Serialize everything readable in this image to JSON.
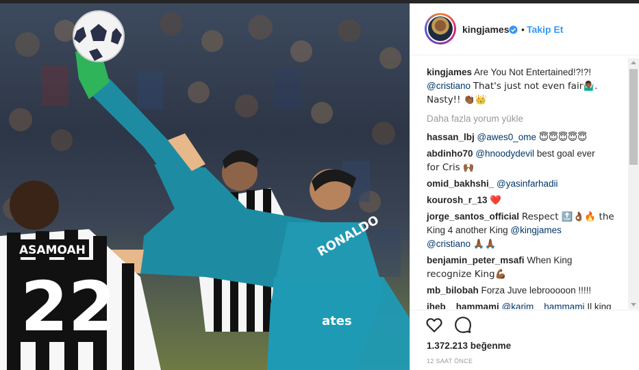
{
  "post": {
    "jersey_name": "ASAMOAH",
    "jersey_number": "22",
    "ball_icon": "football-icon"
  },
  "header": {
    "username": "kingjames",
    "verified_icon": "verified-badge-icon",
    "separator": "•",
    "follow_label": "Takip Et"
  },
  "caption": {
    "username": "kingjames",
    "line1": "Are You Not Entertained!?!?!",
    "line2_mention": "@cristiano",
    "line2_text": "That's just not even fair🤷🏾‍♂️.",
    "line3_text": "Nasty!! 👏🏾👑"
  },
  "load_more": "Daha fazla yorum yükle",
  "comments": [
    {
      "user": "hassan_lbj",
      "mention": "@awes0_ome",
      "text": "😇😇😇😇😇"
    },
    {
      "user": "abdinho70",
      "mention": "@hnoodydevil",
      "text": "best goal ever",
      "text2": "for Cris 🙌🏾"
    },
    {
      "user": "omid_bakhshi_",
      "mention": "@yasinfarhadii",
      "text": ""
    },
    {
      "user": "kourosh_r_13",
      "mention": "",
      "text": "❤️"
    },
    {
      "user": "jorge_santos_official",
      "text": "Respect 🔝👌🏾🔥 the",
      "line2_text": "King 4 another King",
      "line2_mention": "@kingjames",
      "line3_mention": "@cristiano",
      "line3_text": "🙏🏾🙏🏾"
    },
    {
      "user": "benjamin_peter_msafi",
      "text": "When King",
      "text2": "recognize King💪🏾"
    },
    {
      "user": "mb_bilobah",
      "text": "Forza Juve lebrooooon !!!!!"
    },
    {
      "user": "iheb__hammami",
      "mention": "@karim__hammami",
      "text": "Il king"
    }
  ],
  "actions": {
    "like_icon": "heart-icon",
    "comment_icon": "comment-bubble-icon",
    "likes": "1.372.213 beğenme",
    "timestamp": "12 SAAT ÖNCE"
  },
  "colors": {
    "link": "#3897f0",
    "mention": "#003569",
    "muted": "#999999",
    "text": "#262626",
    "real_teal": "#1f8fa6",
    "juve_black": "#111111"
  }
}
